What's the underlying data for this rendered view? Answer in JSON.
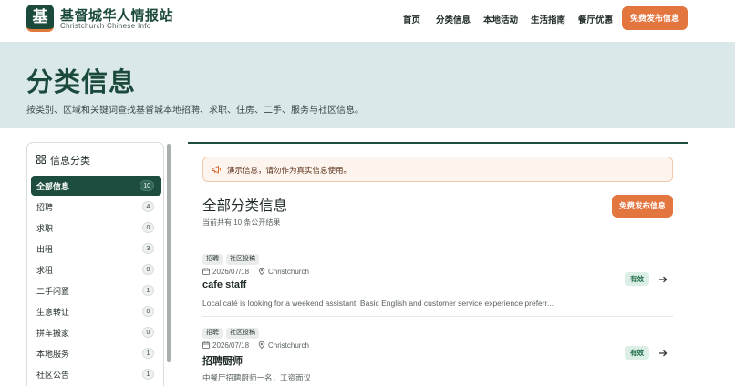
{
  "brand": {
    "logo_char": "基",
    "title": "基督城华人情报站",
    "subtitle": "Christchurch Chinese Info"
  },
  "nav": {
    "items": [
      "首页",
      "分类信息",
      "本地活动",
      "生活指南",
      "餐厅优惠"
    ],
    "cta": "免费发布信息"
  },
  "hero": {
    "title": "分类信息",
    "desc": "按类别、区域和关键词查找基督城本地招聘、求职、住房、二手、服务与社区信息。"
  },
  "sidebar": {
    "heading": "信息分类",
    "items": [
      {
        "label": "全部信息",
        "count": "10",
        "active": true
      },
      {
        "label": "招聘",
        "count": "4"
      },
      {
        "label": "求职",
        "count": "0"
      },
      {
        "label": "出租",
        "count": "3"
      },
      {
        "label": "求租",
        "count": "0"
      },
      {
        "label": "二手闲置",
        "count": "1"
      },
      {
        "label": "生意转让",
        "count": "0"
      },
      {
        "label": "拼车搬家",
        "count": "0"
      },
      {
        "label": "本地服务",
        "count": "1"
      },
      {
        "label": "社区公告",
        "count": "1"
      }
    ]
  },
  "main": {
    "notice": "演示信息，请勿作为真实信息使用。",
    "title": "全部分类信息",
    "subtitle": "当前共有 10 条公开结果",
    "post_button": "免费发布信息",
    "listings": [
      {
        "tags": [
          "招聘",
          "社区投稿"
        ],
        "date": "2026/07/18",
        "location": "Christchurch",
        "title": "cafe staff",
        "desc": "Local café is looking for a weekend assistant. Basic English and customer service experience preferr...",
        "status": "有效"
      },
      {
        "tags": [
          "招聘",
          "社区投稿"
        ],
        "date": "2026/07/18",
        "location": "Christchurch",
        "title": "招聘厨师",
        "desc": "中餐厅招聘厨师一名，工资面议",
        "status": "有效"
      }
    ]
  },
  "colors": {
    "brand_green": "#1b4a3c",
    "accent_orange": "#e3753f",
    "hero_bg": "#dbe8ea"
  }
}
